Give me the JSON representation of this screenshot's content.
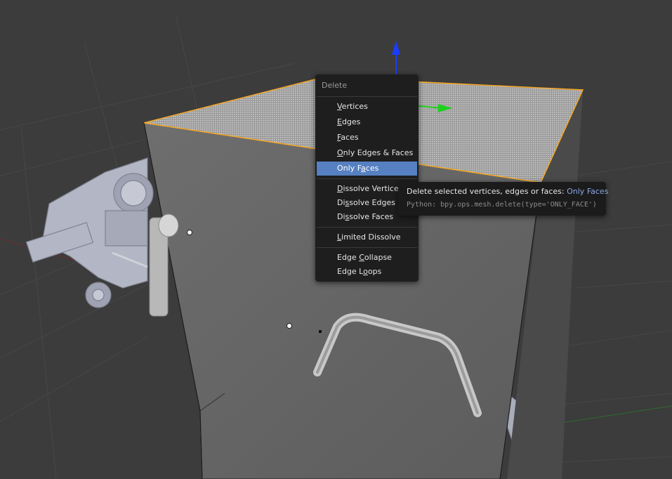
{
  "delete_menu": {
    "title": "Delete",
    "items": [
      {
        "pre": "",
        "ul": "V",
        "post": "ertices"
      },
      {
        "pre": "",
        "ul": "E",
        "post": "dges"
      },
      {
        "pre": "",
        "ul": "F",
        "post": "aces"
      },
      {
        "pre": "",
        "ul": "O",
        "post": "nly Edges & Faces"
      },
      {
        "pre": "Only F",
        "ul": "a",
        "post": "ces"
      },
      {
        "pre": "",
        "ul": "D",
        "post": "issolve Vertices"
      },
      {
        "pre": "Di",
        "ul": "s",
        "post": "solve Edges"
      },
      {
        "pre": "Di",
        "ul": "s",
        "post": "solve Faces"
      },
      {
        "pre": "",
        "ul": "L",
        "post": "imited Dissolve"
      },
      {
        "pre": "Edge ",
        "ul": "C",
        "post": "ollapse"
      },
      {
        "pre": "Edge L",
        "ul": "o",
        "post": "ops"
      }
    ]
  },
  "tooltip": {
    "description": "Delete selected vertices, edges or faces: ",
    "highlight": "Only Faces",
    "python": "Python: bpy.ops.mesh.delete(type='ONLY_FACE')"
  },
  "colors": {
    "background": "#3c3c3c",
    "menu_bg": "#1e1e1e",
    "menu_highlight": "#5680c2",
    "selected_edge": "#f5a623",
    "z_axis": "#1a3cff",
    "y_axis": "#1ed01e"
  }
}
